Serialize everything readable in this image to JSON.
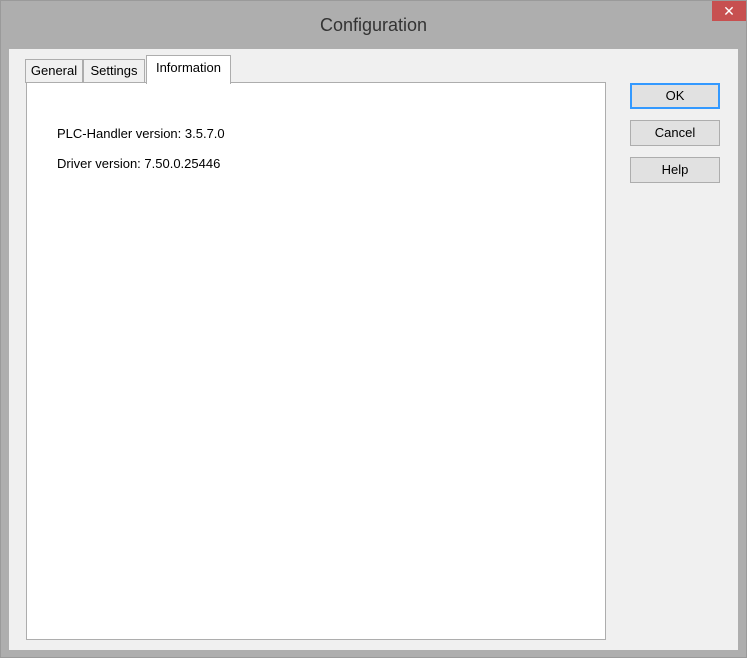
{
  "window": {
    "title": "Configuration",
    "close_glyph": "✕"
  },
  "tabs": [
    {
      "label": "General",
      "active": false
    },
    {
      "label": "Settings",
      "active": false
    },
    {
      "label": "Information",
      "active": true
    }
  ],
  "information": {
    "plc_handler_version": "PLC-Handler version: 3.5.7.0",
    "driver_version": "Driver version: 7.50.0.25446"
  },
  "buttons": {
    "ok": "OK",
    "cancel": "Cancel",
    "help": "Help"
  },
  "colors": {
    "close_button": "#c75050",
    "default_button_border": "#3399ff"
  }
}
